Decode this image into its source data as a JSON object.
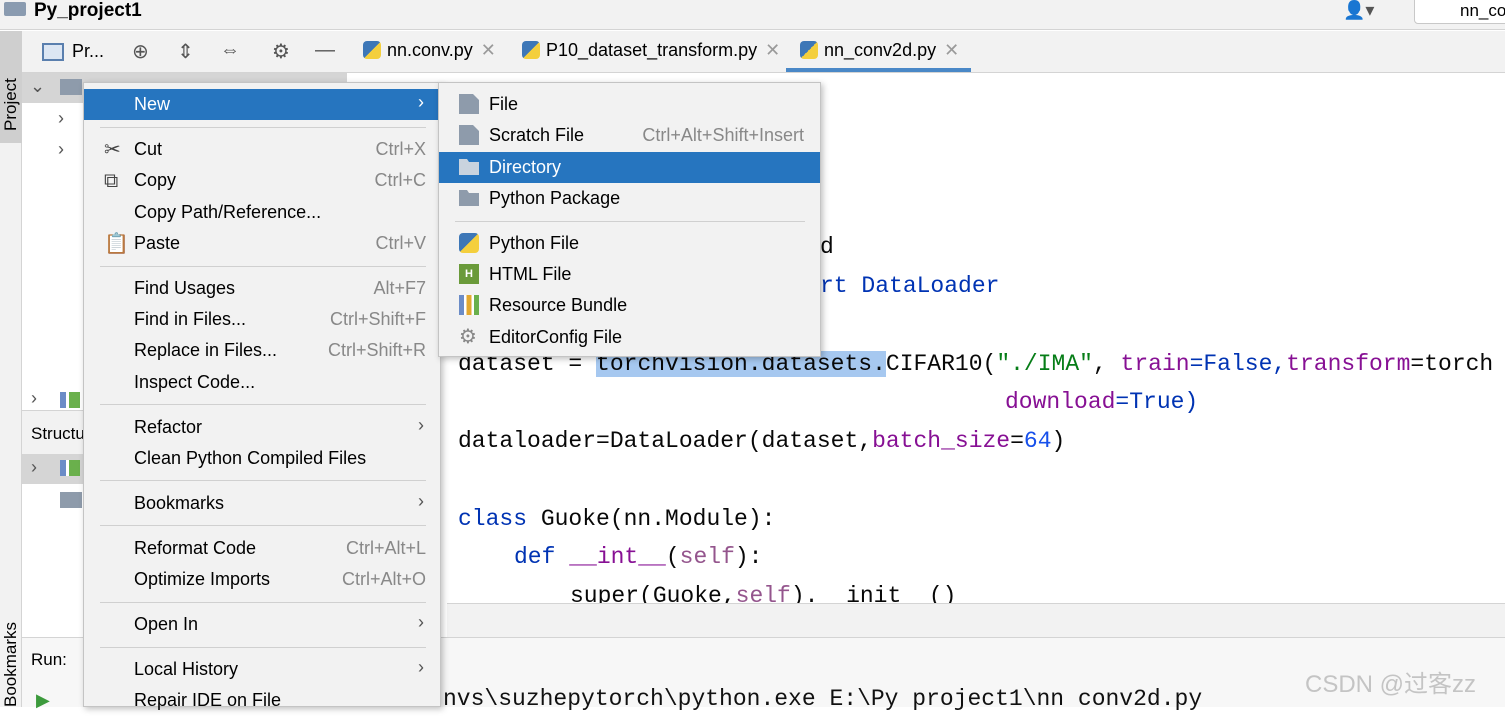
{
  "window": {
    "project_title": "Py_project1",
    "run_config_label": "nn_co"
  },
  "left_stripe": {
    "project_tab": "Project",
    "bookmarks_tab": "Bookmarks"
  },
  "project_panel": {
    "title": "Pr...",
    "structure_label": "Structu",
    "run_label": "Run:"
  },
  "tabs": [
    {
      "label": "nn.conv.py"
    },
    {
      "label": "P10_dataset_transform.py"
    },
    {
      "label": "nn_conv2d.py"
    }
  ],
  "context_menu": {
    "items": [
      {
        "label": "New",
        "shortcut": "",
        "submenu": true
      },
      {
        "label": "Cut",
        "shortcut": "Ctrl+X",
        "icon": "scissors-icon"
      },
      {
        "label": "Copy",
        "shortcut": "Ctrl+C",
        "icon": "copy-icon"
      },
      {
        "label": "Copy Path/Reference...",
        "shortcut": ""
      },
      {
        "label": "Paste",
        "shortcut": "Ctrl+V",
        "icon": "clipboard-icon"
      },
      {
        "label": "Find Usages",
        "shortcut": "Alt+F7"
      },
      {
        "label": "Find in Files...",
        "shortcut": "Ctrl+Shift+F"
      },
      {
        "label": "Replace in Files...",
        "shortcut": "Ctrl+Shift+R"
      },
      {
        "label": "Inspect Code...",
        "shortcut": ""
      },
      {
        "label": "Refactor",
        "submenu": true
      },
      {
        "label": "Clean Python Compiled Files",
        "shortcut": ""
      },
      {
        "label": "Bookmarks",
        "submenu": true
      },
      {
        "label": "Reformat Code",
        "shortcut": "Ctrl+Alt+L"
      },
      {
        "label": "Optimize Imports",
        "shortcut": "Ctrl+Alt+O"
      },
      {
        "label": "Open In",
        "submenu": true
      },
      {
        "label": "Local History",
        "submenu": true
      },
      {
        "label": "Repair IDE on File",
        "shortcut": ""
      }
    ]
  },
  "new_submenu": {
    "items": [
      {
        "label": "File",
        "shortcut": ""
      },
      {
        "label": "Scratch File",
        "shortcut": "Ctrl+Alt+Shift+Insert"
      },
      {
        "label": "Directory",
        "shortcut": ""
      },
      {
        "label": "Python Package",
        "shortcut": ""
      },
      {
        "label": "Python File",
        "shortcut": ""
      },
      {
        "label": "HTML File",
        "shortcut": ""
      },
      {
        "label": "Resource Bundle",
        "shortcut": ""
      },
      {
        "label": "EditorConfig File",
        "shortcut": ""
      }
    ]
  },
  "editor": {
    "line_d": "d",
    "line_import_tail": "rt DataLoader",
    "line_dataset": {
      "a": "dataset = ",
      "b": "torchvision.datasets.",
      "c": "CIFAR10(",
      "d": "\"./IMA\"",
      "e": ", ",
      "f": "train",
      "g": "=False,",
      "h": "transform",
      "i": "=torch"
    },
    "line_download": {
      "a": "download",
      "b": "=True)"
    },
    "line_loader": {
      "a": "dataloader=DataLoader(dataset,",
      "b": "batch_size",
      "c": "=",
      "d": "64",
      "e": ")"
    },
    "line_class": {
      "a": "class",
      "b": " Guoke(nn.Module):"
    },
    "line_def": {
      "a": "def",
      "b": " __int__",
      "c": "(",
      "d": "self",
      "e": "):"
    },
    "line_super": {
      "a": "super(Guoke,",
      "b": "self",
      "c": ").  init  ()"
    }
  },
  "run_output": "nvs\\suzhepytorch\\python.exe E:\\Py project1\\nn conv2d.py",
  "watermark": "CSDN @过客zz"
}
